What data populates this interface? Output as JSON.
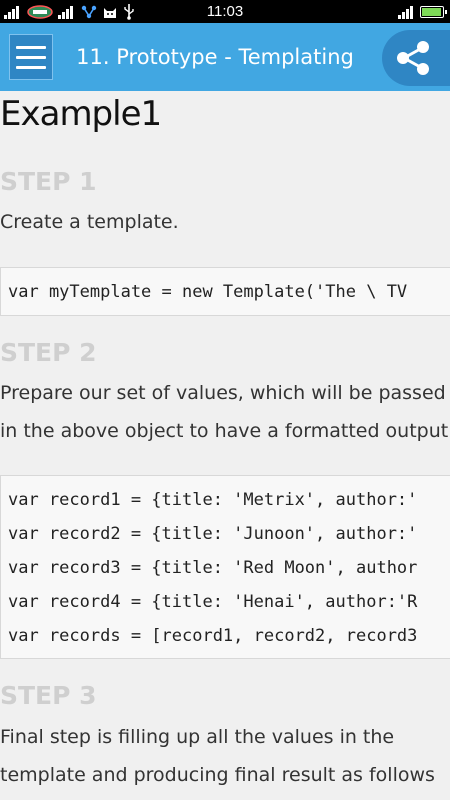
{
  "status_bar": {
    "time": "11:03",
    "battery_color": "#7ed957",
    "left_icons": [
      "signal-icon",
      "carrier-logo-icon",
      "signal-icon",
      "usb-tether-icon",
      "cat-icon",
      "usb-icon"
    ],
    "right_icons": [
      "signal-icon",
      "battery-icon"
    ]
  },
  "app_bar": {
    "title": "11. Prototype - Templating",
    "menu_icon": "hamburger-menu-icon",
    "share_icon": "share-icon",
    "accent_color": "#41a7e2"
  },
  "content": {
    "heading": "Example1",
    "steps": [
      {
        "label": "STEP 1",
        "text_lines": [
          "Create a template."
        ],
        "code_lines": [
          "var myTemplate = new Template('The \\ TV"
        ]
      },
      {
        "label": "STEP 2",
        "text_lines": [
          "Prepare our set of values, which will be passed",
          "in the above object to have a formatted output."
        ],
        "code_lines": [
          "var record1 = {title: 'Metrix', author:'",
          "var record2 = {title: 'Junoon', author:'",
          "var record3 = {title: 'Red Moon', author",
          "var record4 = {title: 'Henai', author:'R",
          "var records = [record1, record2, record3"
        ]
      },
      {
        "label": "STEP 3",
        "text_lines": [
          "Final step is filling up all the values in the",
          "template and producing final result as follows"
        ],
        "code_lines": []
      }
    ]
  }
}
